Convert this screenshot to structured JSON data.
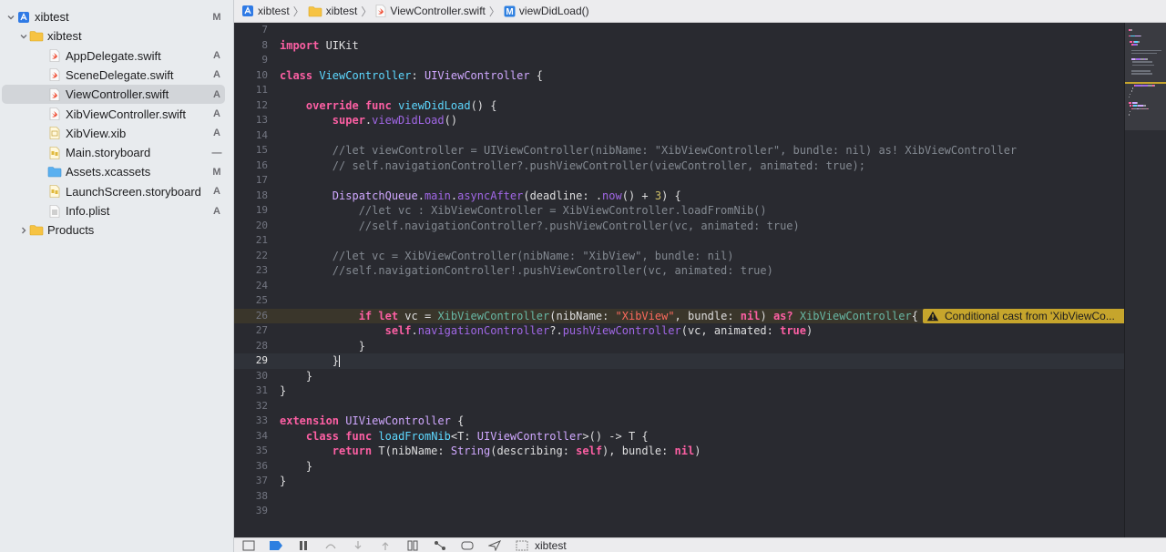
{
  "navigator": {
    "items": [
      {
        "label": "xibtest",
        "badge": "M",
        "icon": "xcode-project-icon",
        "indent": 0,
        "disclosure": "expanded",
        "selected": false
      },
      {
        "label": "xibtest",
        "badge": "",
        "icon": "folder-icon",
        "indent": 1,
        "disclosure": "expanded",
        "selected": false
      },
      {
        "label": "AppDelegate.swift",
        "badge": "A",
        "icon": "swift-file-icon",
        "indent": 2,
        "disclosure": "none",
        "selected": false
      },
      {
        "label": "SceneDelegate.swift",
        "badge": "A",
        "icon": "swift-file-icon",
        "indent": 2,
        "disclosure": "none",
        "selected": false
      },
      {
        "label": "ViewController.swift",
        "badge": "A",
        "icon": "swift-file-icon",
        "indent": 2,
        "disclosure": "none",
        "selected": true
      },
      {
        "label": "XibViewController.swift",
        "badge": "A",
        "icon": "swift-file-icon",
        "indent": 2,
        "disclosure": "none",
        "selected": false
      },
      {
        "label": "XibView.xib",
        "badge": "A",
        "icon": "xib-file-icon",
        "indent": 2,
        "disclosure": "none",
        "selected": false
      },
      {
        "label": "Main.storyboard",
        "badge": "—",
        "icon": "storyboard-file-icon",
        "indent": 2,
        "disclosure": "none",
        "selected": false
      },
      {
        "label": "Assets.xcassets",
        "badge": "M",
        "icon": "assets-folder-icon",
        "indent": 2,
        "disclosure": "none",
        "selected": false
      },
      {
        "label": "LaunchScreen.storyboard",
        "badge": "A",
        "icon": "storyboard-file-icon",
        "indent": 2,
        "disclosure": "none",
        "selected": false
      },
      {
        "label": "Info.plist",
        "badge": "A",
        "icon": "plist-file-icon",
        "indent": 2,
        "disclosure": "none",
        "selected": false
      },
      {
        "label": "Products",
        "badge": "",
        "icon": "folder-icon",
        "indent": 1,
        "disclosure": "collapsed",
        "selected": false
      }
    ]
  },
  "jumpbar": {
    "items": [
      {
        "label": "xibtest",
        "icon": "xcode-project-icon"
      },
      {
        "label": "xibtest",
        "icon": "folder-icon"
      },
      {
        "label": "ViewController.swift",
        "icon": "swift-file-icon"
      },
      {
        "label": "viewDidLoad()",
        "icon": "method-icon"
      }
    ],
    "method_badge": "M"
  },
  "editor": {
    "current_line": 29,
    "warning_line": 26,
    "lines": [
      {
        "n": 7,
        "tokens": []
      },
      {
        "n": 8,
        "tokens": [
          [
            "kw",
            "import"
          ],
          [
            "p",
            " UIKit"
          ]
        ]
      },
      {
        "n": 9,
        "tokens": []
      },
      {
        "n": 10,
        "tokens": [
          [
            "kw",
            "class"
          ],
          [
            "p",
            " "
          ],
          [
            "ut",
            "ViewController"
          ],
          [
            "p",
            ": "
          ],
          [
            "ty",
            "UIViewController"
          ],
          [
            "p",
            " {"
          ]
        ]
      },
      {
        "n": 11,
        "tokens": []
      },
      {
        "n": 12,
        "tokens": [
          [
            "p",
            "    "
          ],
          [
            "kw",
            "override"
          ],
          [
            "p",
            " "
          ],
          [
            "kw",
            "func"
          ],
          [
            "p",
            " "
          ],
          [
            "ut",
            "viewDidLoad"
          ],
          [
            "p",
            "() {"
          ]
        ]
      },
      {
        "n": 13,
        "tokens": [
          [
            "p",
            "        "
          ],
          [
            "kw",
            "super"
          ],
          [
            "p",
            "."
          ],
          [
            "pr",
            "viewDidLoad"
          ],
          [
            "p",
            "()"
          ]
        ]
      },
      {
        "n": 14,
        "tokens": []
      },
      {
        "n": 15,
        "tokens": [
          [
            "cm",
            "        //let viewController = UIViewController(nibName: \"XibViewController\", bundle: nil) as! XibViewController"
          ]
        ]
      },
      {
        "n": 16,
        "tokens": [
          [
            "cm",
            "        // self.navigationController?.pushViewController(viewController, animated: true);"
          ]
        ]
      },
      {
        "n": 17,
        "tokens": []
      },
      {
        "n": 18,
        "tokens": [
          [
            "p",
            "        "
          ],
          [
            "ty",
            "DispatchQueue"
          ],
          [
            "p",
            "."
          ],
          [
            "pr",
            "main"
          ],
          [
            "p",
            "."
          ],
          [
            "pr",
            "asyncAfter"
          ],
          [
            "p",
            "(deadline: ."
          ],
          [
            "pr",
            "now"
          ],
          [
            "p",
            "() + "
          ],
          [
            "nu",
            "3"
          ],
          [
            "p",
            ") {"
          ]
        ]
      },
      {
        "n": 19,
        "tokens": [
          [
            "cm",
            "            //let vc : XibViewController = XibViewController.loadFromNib()"
          ]
        ]
      },
      {
        "n": 20,
        "tokens": [
          [
            "cm",
            "            //self.navigationController?.pushViewController(vc, animated: true)"
          ]
        ]
      },
      {
        "n": 21,
        "tokens": []
      },
      {
        "n": 22,
        "tokens": [
          [
            "cm",
            "        //let vc = XibViewController(nibName: \"XibView\", bundle: nil)"
          ]
        ]
      },
      {
        "n": 23,
        "tokens": [
          [
            "cm",
            "        //self.navigationController!.pushViewController(vc, animated: true)"
          ]
        ]
      },
      {
        "n": 24,
        "tokens": []
      },
      {
        "n": 25,
        "tokens": []
      },
      {
        "n": 26,
        "tokens": [
          [
            "p",
            "            "
          ],
          [
            "kw",
            "if"
          ],
          [
            "p",
            " "
          ],
          [
            "kw",
            "let"
          ],
          [
            "p",
            " vc = "
          ],
          [
            "fn",
            "XibViewController"
          ],
          [
            "p",
            "(nibName: "
          ],
          [
            "st",
            "\"XibView\""
          ],
          [
            "p",
            ", bundle: "
          ],
          [
            "kw",
            "nil"
          ],
          [
            "p",
            ") "
          ],
          [
            "kw",
            "as?"
          ],
          [
            "p",
            " "
          ],
          [
            "fn",
            "XibViewController"
          ],
          [
            "p",
            "{"
          ]
        ]
      },
      {
        "n": 27,
        "tokens": [
          [
            "p",
            "                "
          ],
          [
            "kw",
            "self"
          ],
          [
            "p",
            "."
          ],
          [
            "pr",
            "navigationController"
          ],
          [
            "p",
            "?."
          ],
          [
            "pr",
            "pushViewController"
          ],
          [
            "p",
            "(vc, animated: "
          ],
          [
            "kw",
            "true"
          ],
          [
            "p",
            ")"
          ]
        ]
      },
      {
        "n": 28,
        "tokens": [
          [
            "p",
            "            }"
          ]
        ]
      },
      {
        "n": 29,
        "tokens": [
          [
            "p",
            "        }"
          ]
        ]
      },
      {
        "n": 30,
        "tokens": [
          [
            "p",
            "    }"
          ]
        ]
      },
      {
        "n": 31,
        "tokens": [
          [
            "p",
            "}"
          ]
        ]
      },
      {
        "n": 32,
        "tokens": []
      },
      {
        "n": 33,
        "tokens": [
          [
            "kw",
            "extension"
          ],
          [
            "p",
            " "
          ],
          [
            "ty",
            "UIViewController"
          ],
          [
            "p",
            " {"
          ]
        ]
      },
      {
        "n": 34,
        "tokens": [
          [
            "p",
            "    "
          ],
          [
            "kw",
            "class"
          ],
          [
            "p",
            " "
          ],
          [
            "kw",
            "func"
          ],
          [
            "p",
            " "
          ],
          [
            "ut",
            "loadFromNib"
          ],
          [
            "p",
            "<T: "
          ],
          [
            "ty",
            "UIViewController"
          ],
          [
            "p",
            ">() -> T {"
          ]
        ]
      },
      {
        "n": 35,
        "tokens": [
          [
            "p",
            "        "
          ],
          [
            "kw",
            "return"
          ],
          [
            "p",
            " T(nibName: "
          ],
          [
            "ty",
            "String"
          ],
          [
            "p",
            "(describing: "
          ],
          [
            "kw",
            "self"
          ],
          [
            "p",
            "), bundle: "
          ],
          [
            "kw",
            "nil"
          ],
          [
            "p",
            ")"
          ]
        ]
      },
      {
        "n": 36,
        "tokens": [
          [
            "p",
            "    }"
          ]
        ]
      },
      {
        "n": 37,
        "tokens": [
          [
            "p",
            "}"
          ]
        ]
      },
      {
        "n": 38,
        "tokens": []
      },
      {
        "n": 39,
        "tokens": []
      }
    ]
  },
  "warning": {
    "text": "Conditional cast from 'XibViewCo...",
    "icon": "warning-triangle-icon",
    "color": "#c6a52c"
  },
  "debugbar": {
    "target_label": "xibtest",
    "buttons": [
      "toggle-console-icon",
      "breakpoints-icon",
      "pause-icon",
      "step-over-icon",
      "step-into-icon",
      "step-out-icon",
      "view-hierarchy-icon",
      "memory-graph-icon",
      "environment-icon",
      "location-icon",
      "target-icon"
    ]
  }
}
